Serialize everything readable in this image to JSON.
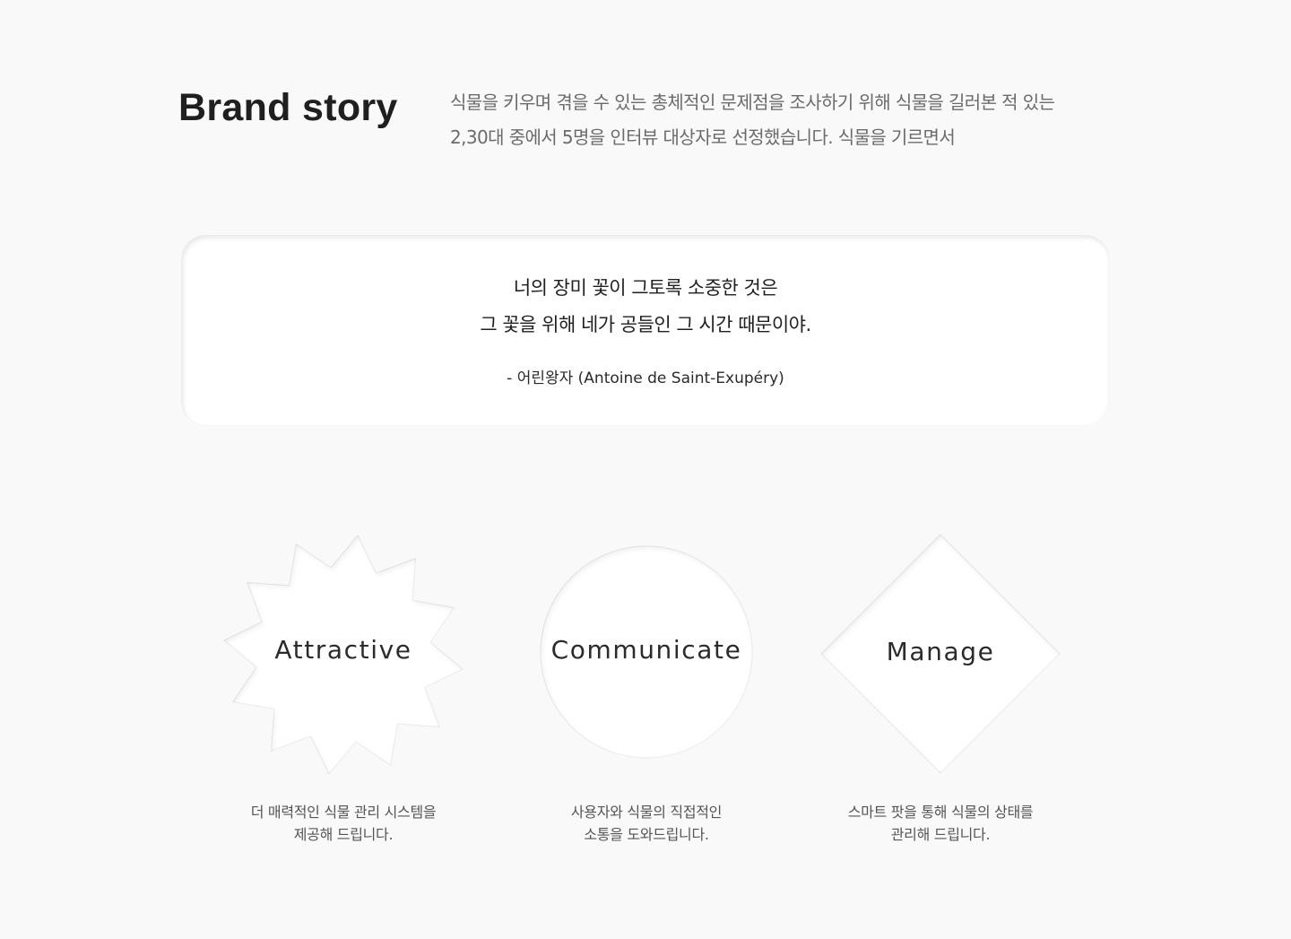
{
  "header": {
    "title": "Brand story",
    "intro_lines": [
      "식물을 키우며 겪을 수 있는 총체적인 문제점을 조사하기 위해 식물을 길러본 적 있는",
      "2,30대 중에서 5명을 인터뷰 대상자로 선정했습니다. 식물을 기르면서"
    ]
  },
  "quote": {
    "lines": [
      "너의 장미 꽃이 그토록 소중한 것은",
      "그 꽃을 위해 네가 공들인 그 시간 때문이야."
    ],
    "author": "- 어린왕자 (Antoine de Saint-Exupéry)"
  },
  "values": [
    {
      "shape": "starburst",
      "label": "Attractive",
      "description": [
        "더 매력적인 식물 관리 시스템을",
        "제공해 드립니다."
      ]
    },
    {
      "shape": "circle",
      "label": "Communicate",
      "description": [
        "사용자와 식물의 직접적인",
        "소통을 도와드립니다."
      ]
    },
    {
      "shape": "diamond",
      "label": "Manage",
      "description": [
        "스마트 팟을 통해 식물의 상태를",
        "관리해 드립니다."
      ]
    }
  ],
  "colors": {
    "background": "#f9f9f9",
    "card": "#ffffff",
    "title": "#1f1f1f",
    "body_text": "#6b6b6b"
  }
}
